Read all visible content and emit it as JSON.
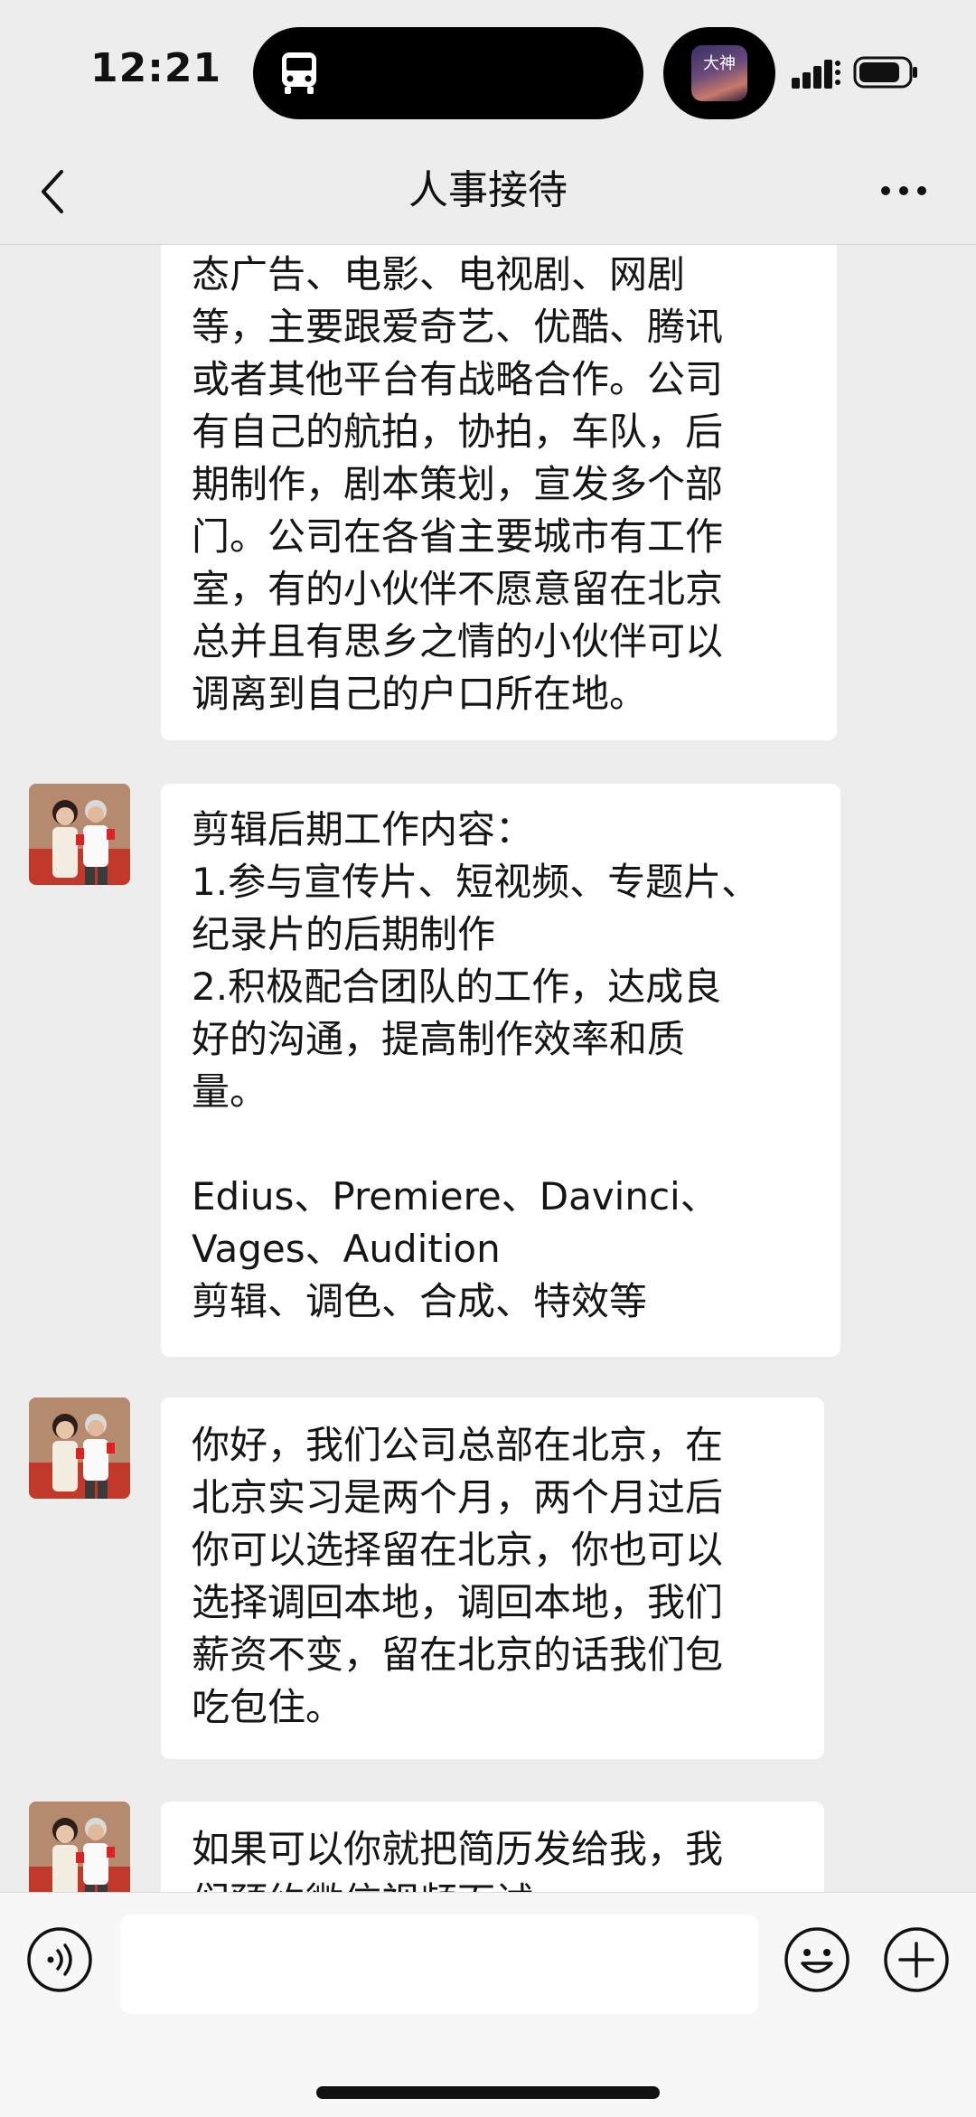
{
  "status_bar": {
    "time": "12:21",
    "album_text": "大神"
  },
  "header": {
    "title": "人事接待"
  },
  "messages": [
    {
      "lines": [
        "态广告、电影、电视剧、网剧",
        "等，主要跟爱奇艺、优酷、腾讯",
        "或者其他平台有战略合作。公司",
        "有自己的航拍，协拍，车队，后",
        "期制作，剧本策划，宣发多个部",
        "门。公司在各省主要城市有工作",
        "室，有的小伙伴不愿意留在北京",
        "总并且有思乡之情的小伙伴可以",
        "调离到自己的户口所在地。"
      ]
    },
    {
      "lines": [
        "剪辑后期工作内容：",
        "1.参与宣传片、短视频、专题片、",
        "纪录片的后期制作",
        "2.积极配合团队的工作，达成良",
        "好的沟通，提高制作效率和质",
        "量。",
        "",
        "Edius、Premiere、Davinci、",
        "Vages、Audition",
        "剪辑、调色、合成、特效等"
      ]
    },
    {
      "lines": [
        "你好，我们公司总部在北京，在",
        "北京实习是两个月，两个月过后",
        "你可以选择留在北京，你也可以",
        "选择调回本地，调回本地，我们",
        "薪资不变，留在北京的话我们包",
        "吃包住。"
      ]
    },
    {
      "lines": [
        "如果可以你就把简历发给我，我",
        "们预约微信视频面试"
      ]
    }
  ],
  "input": {
    "value": "",
    "placeholder": ""
  }
}
